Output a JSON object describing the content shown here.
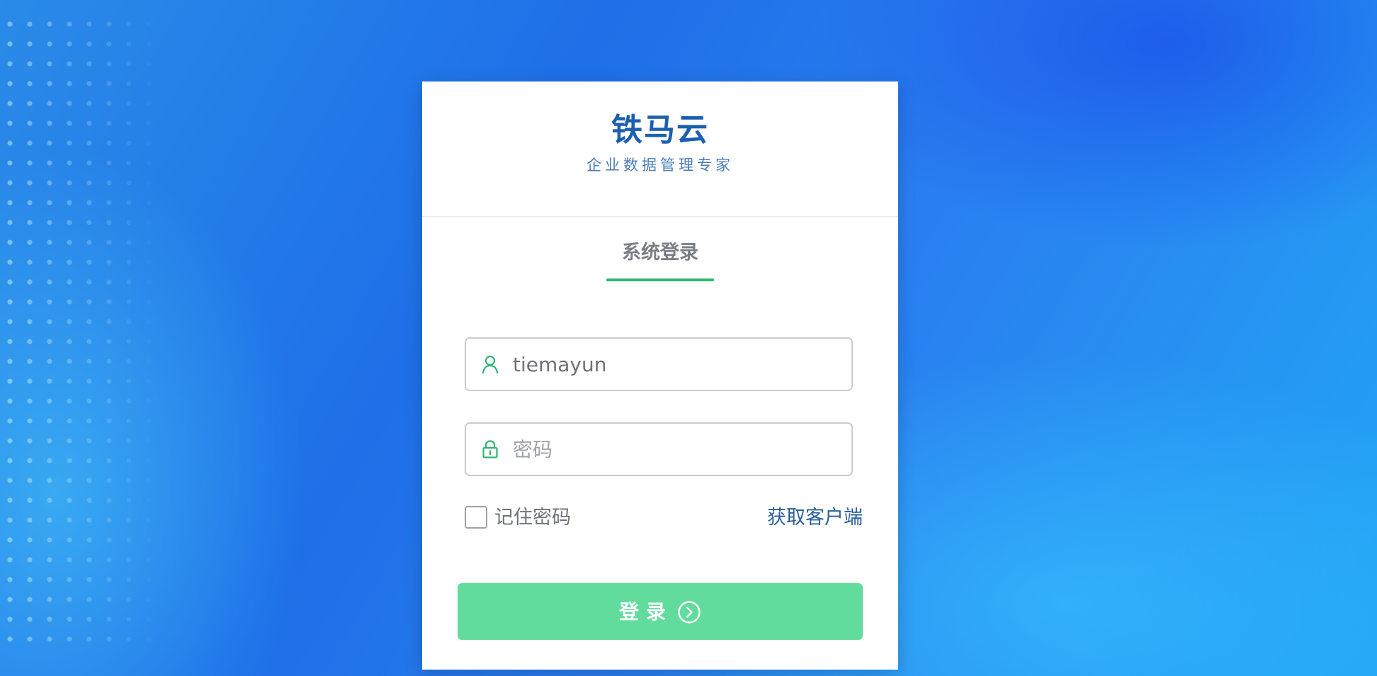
{
  "brand": {
    "name": "铁马云",
    "slogan": "企业数据管理专家"
  },
  "login_tab": {
    "label": "系统登录"
  },
  "username": {
    "value": "tiemayun",
    "icon": "user-icon"
  },
  "password": {
    "placeholder": "密码",
    "icon": "lock-icon"
  },
  "remember": {
    "label": "记住密码",
    "checked": false
  },
  "client_link": {
    "label": "获取客户端"
  },
  "login_button": {
    "label": "登录",
    "icon": "arrow-right-circle-icon"
  },
  "colors": {
    "accent_green": "#2fb670",
    "button_green": "#62dc9c",
    "brand_blue": "#1b5fb0",
    "link_blue": "#2a5e9c"
  }
}
